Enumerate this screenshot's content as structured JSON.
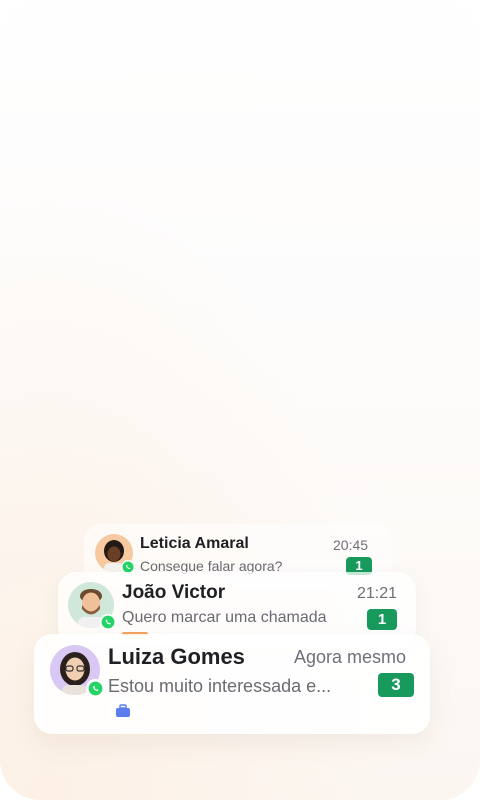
{
  "notifications": [
    {
      "name": "Leticia Amaral",
      "time": "20:45",
      "preview": "Consegue falar agora?",
      "unread": "1",
      "channel_icon": "whatsapp-icon"
    },
    {
      "name": "João Victor",
      "time": "21:21",
      "preview": "Quero marcar uma chamada",
      "unread": "1",
      "channel_icon": "whatsapp-icon",
      "tag_color": "#f4a25a"
    },
    {
      "name": "Luiza Gomes",
      "time": "Agora mesmo",
      "preview": "Estou muito interessada e...",
      "unread": "3",
      "channel_icon": "whatsapp-icon",
      "tag_icon": "briefcase-icon",
      "tag_color": "#5b7df0"
    }
  ],
  "colors": {
    "badge": "#179a5c",
    "whatsapp": "#25d366"
  }
}
